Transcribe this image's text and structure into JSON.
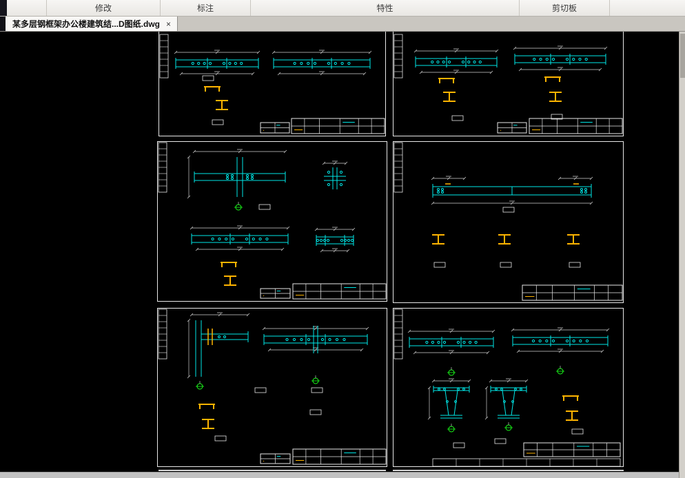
{
  "ribbon": {
    "panels": [
      {
        "label": "修改"
      },
      {
        "label": "标注"
      },
      {
        "label": "特性"
      },
      {
        "label": "剪切板"
      }
    ]
  },
  "tab_bar": {
    "file_tab": {
      "title": "某多层钢框架办公楼建筑结...D图纸.dwg",
      "close_glyph": "×"
    }
  },
  "canvas": {
    "background": "#000000",
    "sheet_count": 6
  },
  "colors": {
    "beam_cyan": "#00e8e8",
    "steel_yellow": "#ffb400",
    "line_white": "#e8e8e8",
    "dim_gray": "#cfcfcf",
    "marker_green": "#19ff19",
    "ribbon_bg": "#f0efec",
    "tab_active_bg": "#f8f7f5"
  }
}
